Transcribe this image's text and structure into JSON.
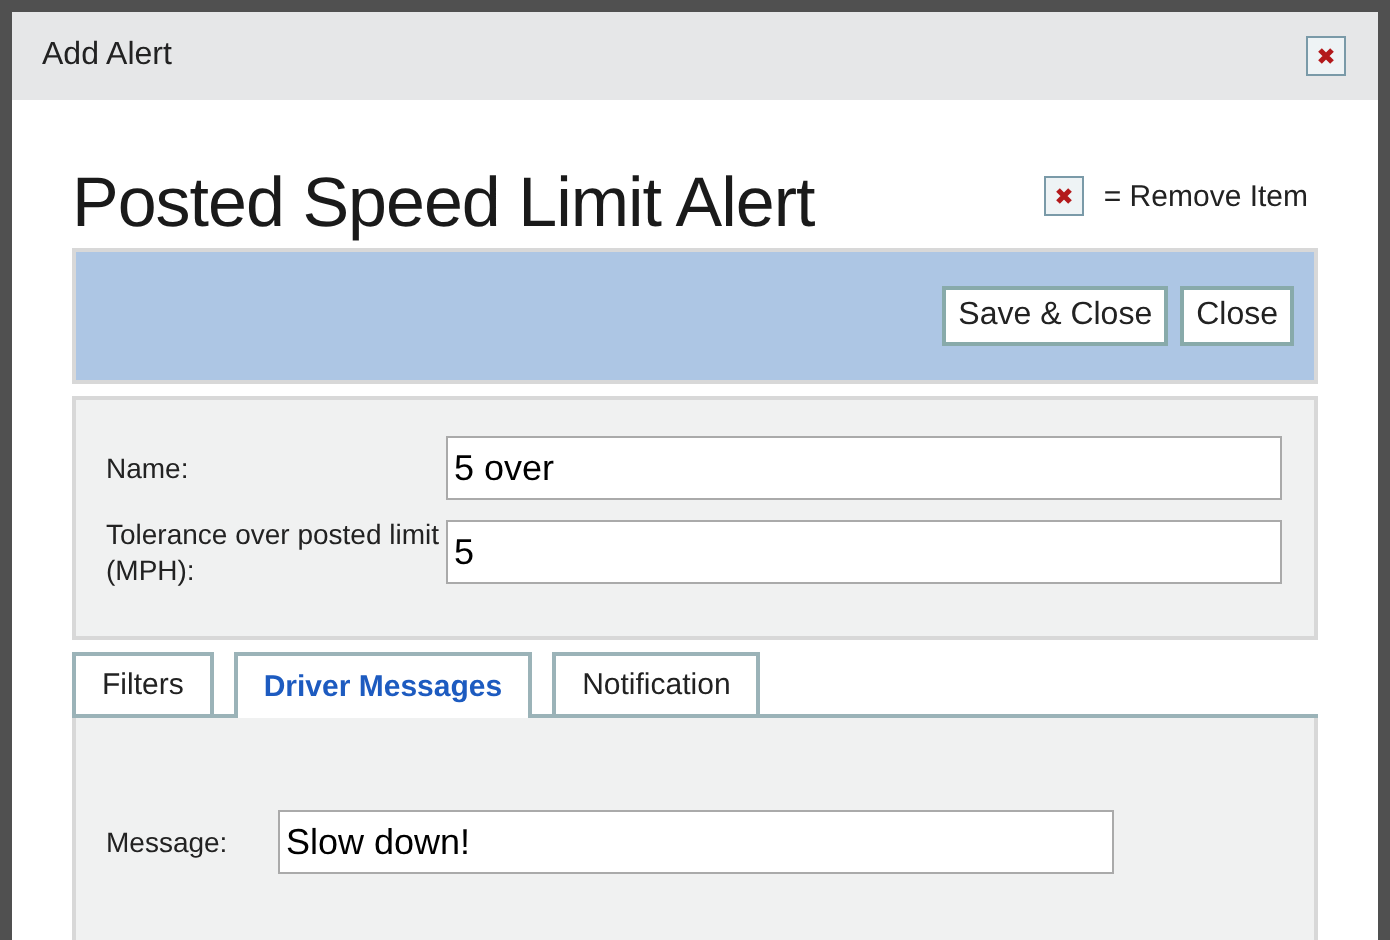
{
  "window": {
    "title": "Add Alert"
  },
  "heading": "Posted Speed Limit Alert",
  "legend": {
    "text": "= Remove Item"
  },
  "buttons": [
    "Save & Close",
    "Close"
  ],
  "fields": [
    {
      "label": "Name:",
      "value": "5 over"
    },
    {
      "label": "Tolerance over posted limit (MPH):",
      "value": "5"
    }
  ],
  "tabs": [
    {
      "label": "Filters",
      "selected": false
    },
    {
      "label": "Driver Messages",
      "selected": true
    },
    {
      "label": "Notification",
      "selected": false
    }
  ],
  "message": {
    "label": "Message:",
    "value": "Slow down!"
  }
}
